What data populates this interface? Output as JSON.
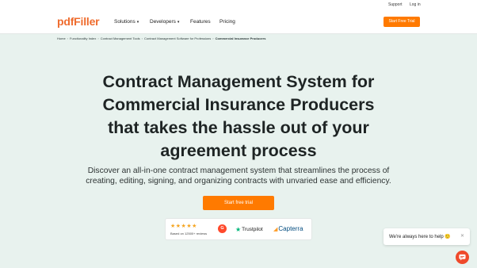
{
  "utility": {
    "support": "Support",
    "login": "Log in"
  },
  "header": {
    "logo": "pdfFiller",
    "nav": [
      {
        "label": "Solutions",
        "chevron": true
      },
      {
        "label": "Developers",
        "chevron": true
      },
      {
        "label": "Features",
        "chevron": false
      },
      {
        "label": "Pricing",
        "chevron": false
      }
    ],
    "cta": "Start Free Trial"
  },
  "breadcrumb": [
    "Home",
    "Functionality Index",
    "Contract Management Tools",
    "Contract Management Software for Professions",
    "Commercial Insurance Producers"
  ],
  "hero": {
    "headline_lines": [
      "Contract Management System for",
      "Commercial Insurance Producers",
      "that takes the hassle out of your",
      "agreement process"
    ],
    "sub_lines": [
      "Discover an all-in-one contract management system that streamlines the process of",
      "creating, editing, signing, and organizing contracts with unvaried ease and efficiency."
    ],
    "cta": "Start free trial"
  },
  "ratings": {
    "stars": "★★★★★",
    "rating_value": 4.5,
    "based_on": "Based on 12500+ reviews",
    "g2_label": "G",
    "trustpilot": "Trustpilot",
    "capterra": "Capterra"
  },
  "chat": {
    "message": "We're always here to help 🙂",
    "close": "✕"
  },
  "colors": {
    "accent": "#ff7a00",
    "brand": "#ef6c2e",
    "background": "#e8f2ee"
  }
}
